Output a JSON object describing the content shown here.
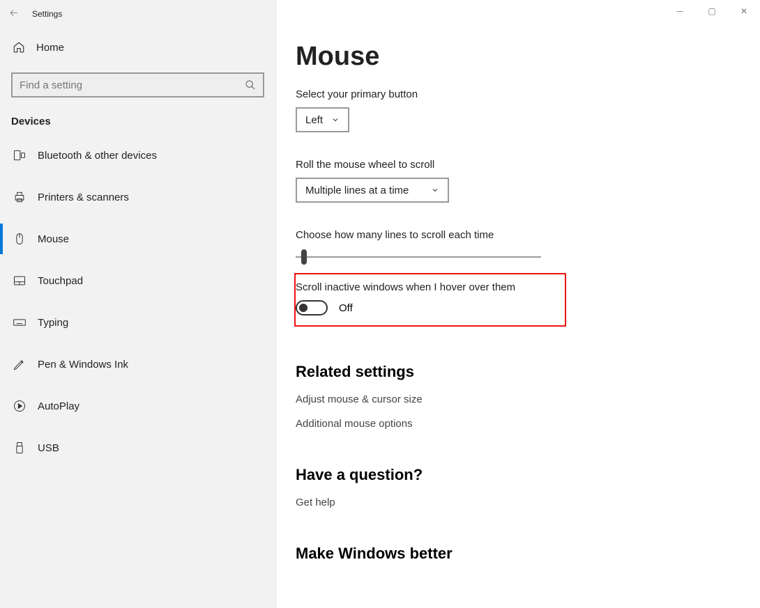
{
  "window": {
    "title": "Settings"
  },
  "sidebar": {
    "home_label": "Home",
    "search_placeholder": "Find a setting",
    "category": "Devices",
    "items": [
      {
        "label": "Bluetooth & other devices"
      },
      {
        "label": "Printers & scanners"
      },
      {
        "label": "Mouse"
      },
      {
        "label": "Touchpad"
      },
      {
        "label": "Typing"
      },
      {
        "label": "Pen & Windows Ink"
      },
      {
        "label": "AutoPlay"
      },
      {
        "label": "USB"
      }
    ]
  },
  "main": {
    "title": "Mouse",
    "primary_button_label": "Select your primary button",
    "primary_button_value": "Left",
    "roll_wheel_label": "Roll the mouse wheel to scroll",
    "roll_wheel_value": "Multiple lines at a time",
    "lines_label": "Choose how many lines to scroll each time",
    "scroll_inactive_label": "Scroll inactive windows when I hover over them",
    "scroll_inactive_value": "Off",
    "related_heading": "Related settings",
    "related_1": "Adjust mouse & cursor size",
    "related_2": "Additional mouse options",
    "question_heading": "Have a question?",
    "get_help": "Get help",
    "improve_heading": "Make Windows better"
  }
}
